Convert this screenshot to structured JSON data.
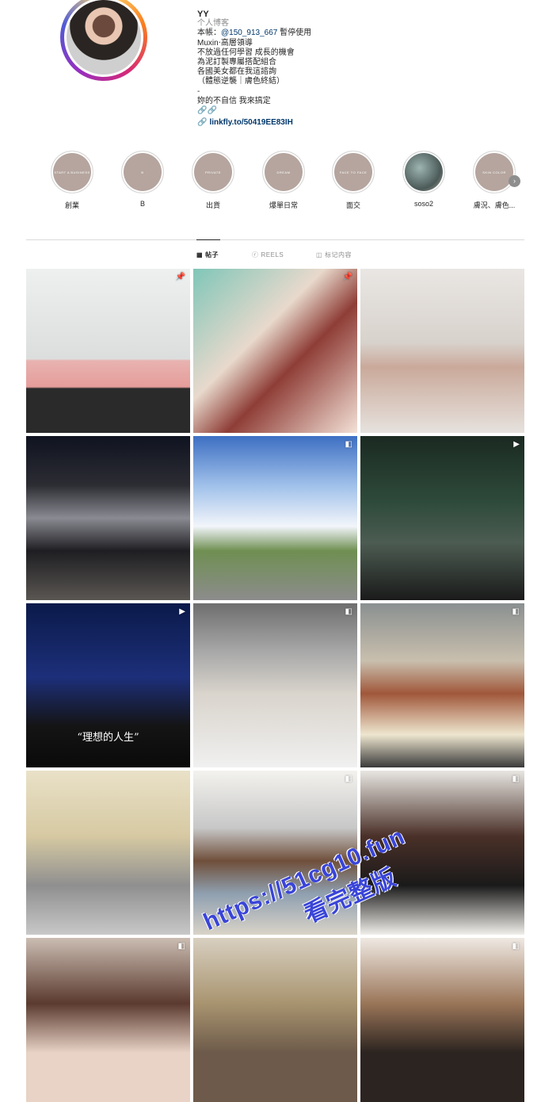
{
  "profile": {
    "name": "YY",
    "category": "个人博客",
    "bio_lines": {
      "l1_prefix": "本帳：",
      "l1_mention": "@150_913_667",
      "l1_suffix": " 暫停使用",
      "l2": "Muxin‧高層領導",
      "l3": "不放過任何學習 成長的機會",
      "l4": "為泥訂製專屬搭配組合",
      "l5": "各國美女都在我這諮詢",
      "l6": "（體態逆襲｜膚色終結）",
      "l7": "-",
      "l8": "妳的不自信 我來搞定",
      "l9": "🔗🔗"
    },
    "link": "linkfly.to/50419EE83IH"
  },
  "highlights": [
    {
      "label": "創業",
      "mini": "START A BUSINESS"
    },
    {
      "label": "B",
      "mini": "B"
    },
    {
      "label": "出貨",
      "mini": "PRIVATE"
    },
    {
      "label": "爆單日常",
      "mini": "DREAM"
    },
    {
      "label": "面交",
      "mini": "FACE TO FACE"
    },
    {
      "label": "soso2",
      "mini": ""
    },
    {
      "label": "膚況、膚色...",
      "mini": "SKIN COLOR"
    }
  ],
  "tabs": {
    "posts": "帖子",
    "reels": "REELS",
    "tagged": "标记内容"
  },
  "posts": [
    {
      "bg": "linear-gradient(180deg,#eef0f0 0%,#dcdedd 55%,#e8b3b0 56%,#e59d9a 72%,#2a2a2a 73%)",
      "badge": "📌",
      "caption": ""
    },
    {
      "bg": "linear-gradient(135deg,#7fc6b8 0%,#e8d9cc 40%,#8e3d36 60%,#f3e1d7 100%)",
      "badge": "📌",
      "caption": ""
    },
    {
      "bg": "linear-gradient(180deg,#e9e6e3 0%,#d8d2cc 45%,#caa99a 60%,#e6e2de 100%)",
      "badge": "",
      "caption": ""
    },
    {
      "bg": "linear-gradient(180deg,#0f1320 0%,#2c2c33 30%,#8a8a92 50%,#1e1e22 70%,#5a5652 100%)",
      "badge": "",
      "caption": ""
    },
    {
      "bg": "linear-gradient(180deg,#3d6fc2 0%,#9fc0ea 30%,#f2f5fa 55%,#6f8f52 70%,#8c8c8c 100%)",
      "badge": "◧",
      "caption": ""
    },
    {
      "bg": "linear-gradient(180deg,#1b2a22 0%,#2e4a3a 40%,#4c5c52 65%,#1a1a1a 100%)",
      "badge": "▶",
      "caption": ""
    },
    {
      "bg": "linear-gradient(180deg,#0b1a4a 0%,#1d2f7a 45%,#141414 75%,#0a0a0a 100%)",
      "badge": "▶",
      "caption": "“理想的人生”"
    },
    {
      "bg": "linear-gradient(180deg,#6e6e6e 0%,#a9a9a9 30%,#d9d4cc 55%,#f0f0f0 100%)",
      "badge": "◧",
      "caption": ""
    },
    {
      "bg": "linear-gradient(180deg,#8a9090 0%,#c9bfae 35%,#a0573a 55%,#eee6cf 80%,#3a3a3a 100%)",
      "badge": "◧",
      "caption": ""
    },
    {
      "bg": "linear-gradient(180deg,#e9e1c8 0%,#d6c9a2 40%,#8f8f8f 70%,#c8c8c8 100%)",
      "badge": "",
      "caption": ""
    },
    {
      "bg": "linear-gradient(180deg,#f3f2ee 0%,#c7c7c7 35%,#6f4f3a 55%,#8fa0b0 75%,#d9d3c8 100%)",
      "badge": "◧",
      "caption": ""
    },
    {
      "bg": "linear-gradient(180deg,#e8e6e2 0%,#4a3028 40%,#1a1a1a 70%,#f1efea 100%)",
      "badge": "◧",
      "caption": ""
    },
    {
      "bg": "linear-gradient(180deg,#cbbdb2 0%,#5b3a2f 40%,#e8d3c6 70%)",
      "badge": "◧",
      "caption": ""
    },
    {
      "bg": "linear-gradient(180deg,#d8cfc0 0%,#a8946f 40%,#6d5a4a 70%)",
      "badge": "",
      "caption": ""
    },
    {
      "bg": "linear-gradient(180deg,#efe9e3 0%,#9a7558 40%,#2c2420 70%)",
      "badge": "◧",
      "caption": ""
    }
  ],
  "watermark": {
    "line1": "https://51cg10.fun",
    "line2": "看完整版"
  }
}
